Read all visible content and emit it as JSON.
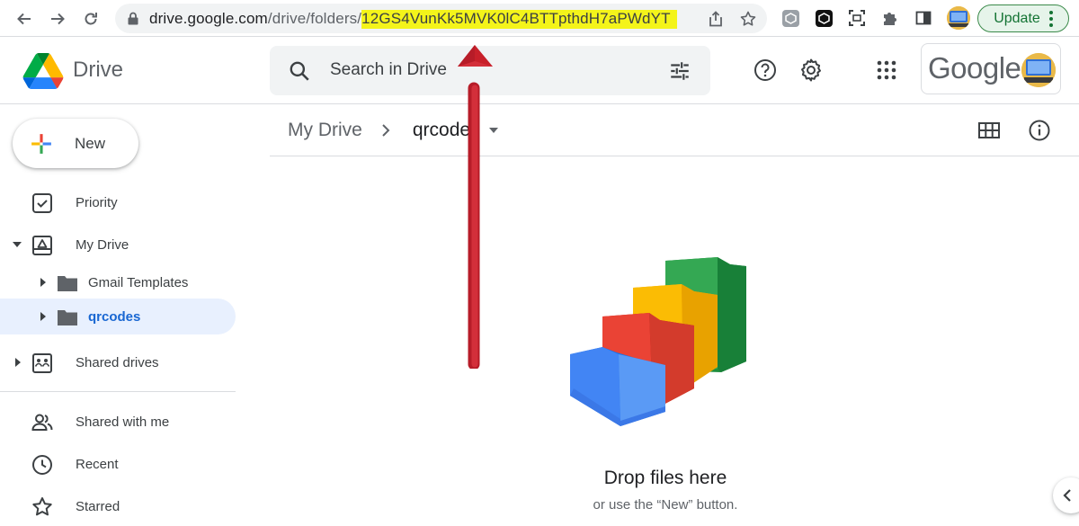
{
  "browser": {
    "url_prefix": "drive.google.com",
    "url_path": "/drive/folders/",
    "url_folder_id": "12GS4VunKk5MVK0lC4BTTpthdH7aPWdYT",
    "update_label": "Update",
    "icons": [
      "back-arrow-icon",
      "forward-arrow-icon",
      "reload-icon",
      "lock-icon",
      "share-icon",
      "star-icon",
      "extension-icon",
      "puzzle-icon",
      "side-panel-icon"
    ]
  },
  "header": {
    "app_name": "Drive",
    "search_placeholder": "Search in Drive",
    "account_wordmark": "Google",
    "brand_colors": {
      "blue": "#4285f4",
      "green": "#34a853",
      "yellow": "#fbbc04",
      "red": "#ea4335"
    }
  },
  "sidebar": {
    "new_label": "New",
    "items": [
      {
        "label": "Priority",
        "icon": "priority-icon"
      },
      {
        "label": "My Drive",
        "icon": "my-drive-icon",
        "expanded": true
      },
      {
        "label": "Gmail Templates",
        "icon": "folder-icon"
      },
      {
        "label": "qrcodes",
        "icon": "folder-icon",
        "selected": true
      },
      {
        "label": "Shared drives",
        "icon": "shared-drives-icon"
      },
      {
        "label": "Shared with me",
        "icon": "people-icon"
      },
      {
        "label": "Recent",
        "icon": "clock-icon"
      },
      {
        "label": "Starred",
        "icon": "star-icon"
      }
    ]
  },
  "main": {
    "breadcrumb": [
      "My Drive",
      "qrcodes"
    ],
    "empty_title": "Drop files here",
    "empty_subtitle": "or use the “New” button."
  },
  "annotation": {
    "color": "#c8202a"
  }
}
